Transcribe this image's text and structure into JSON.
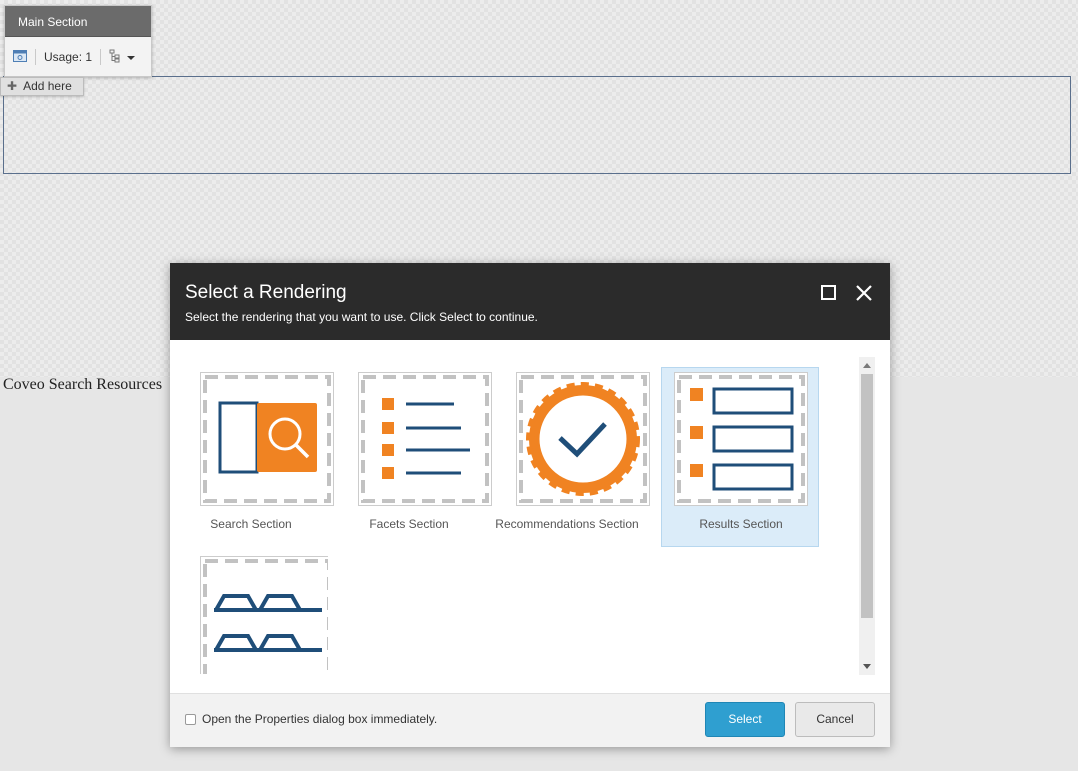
{
  "chrome": {
    "title": "Main Section",
    "usage_label": "Usage: 1",
    "add_here_label": "Add here"
  },
  "page": {
    "text": "Coveo Search Resources"
  },
  "dialog": {
    "title": "Select a Rendering",
    "subtitle": "Select the rendering that you want to use. Click Select to continue.",
    "renderings": [
      {
        "label": "Search Section",
        "icon": "search-section-icon",
        "selected": false
      },
      {
        "label": "Facets Section",
        "icon": "facets-section-icon",
        "selected": false
      },
      {
        "label": "Recommendations Section",
        "icon": "recommendations-section-icon",
        "selected": false
      },
      {
        "label": "Results Section",
        "icon": "results-section-icon",
        "selected": true
      },
      {
        "label": "",
        "icon": "gold-bars-icon",
        "selected": false
      }
    ],
    "checkbox_label": "Open the Properties dialog box immediately.",
    "checkbox_checked": false,
    "select_label": "Select",
    "cancel_label": "Cancel"
  },
  "colors": {
    "accent_orange": "#F08322",
    "navy": "#1F4E79",
    "selected_bg": "#DBECF9",
    "select_button": "#2F9FD0",
    "dialog_header": "#2B2B2B"
  }
}
